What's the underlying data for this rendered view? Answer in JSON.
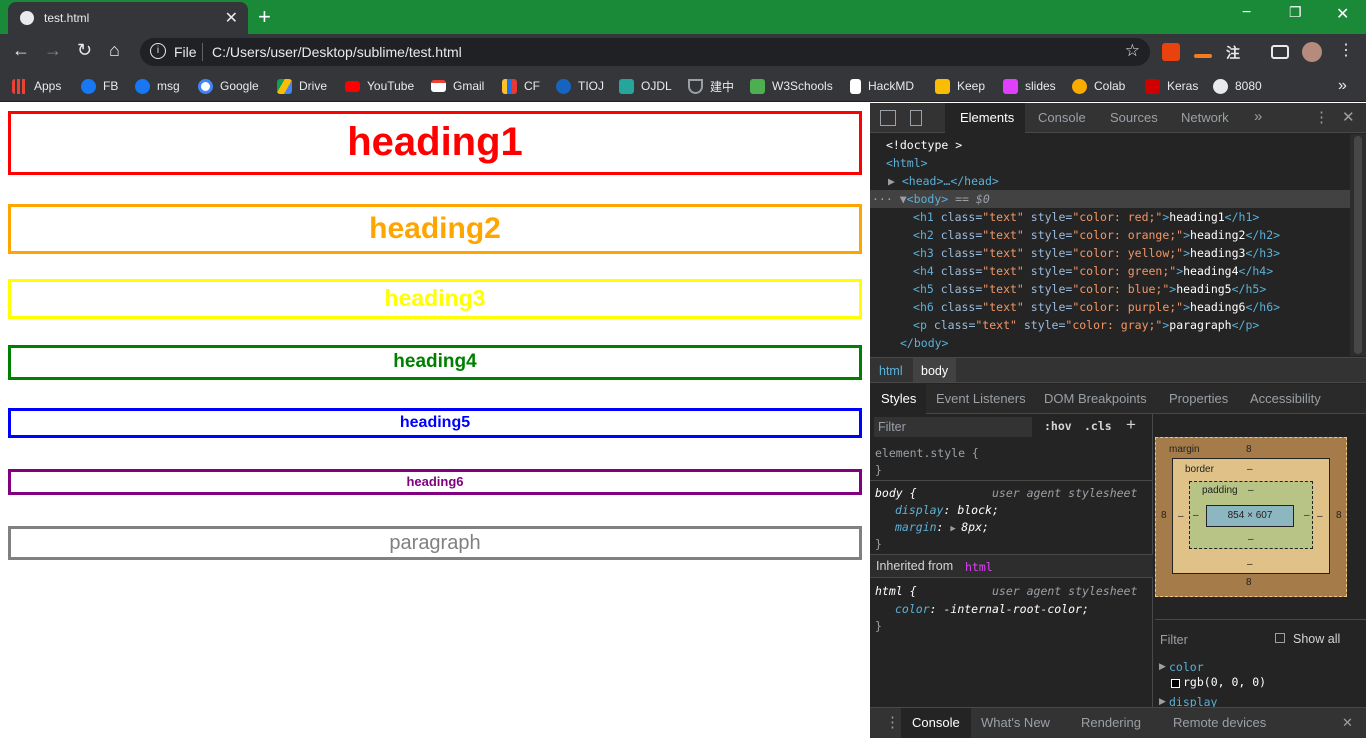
{
  "browser": {
    "tab_title": "test.html",
    "tab_close": "✕",
    "new_tab": "+",
    "window_controls": {
      "minimize": "−",
      "restore": "❐",
      "close": "✕"
    },
    "nav": {
      "back": "←",
      "forward": "→",
      "reload": "↻",
      "home": "⌂"
    },
    "omnibox": {
      "info": "i",
      "scheme": "File",
      "url": "C:/Users/user/Desktop/sublime/test.html",
      "star": "☆"
    },
    "bookmarks": [
      {
        "label": "Apps",
        "icon": "apps-icon",
        "color": "#ea4335"
      },
      {
        "label": "FB",
        "icon": "facebook-icon",
        "color": "#1877f2"
      },
      {
        "label": "msg",
        "icon": "facebook-icon",
        "color": "#1877f2"
      },
      {
        "label": "Google",
        "icon": "google-icon",
        "color": "#ffffff"
      },
      {
        "label": "Drive",
        "icon": "drive-icon",
        "color": "#fbbc04"
      },
      {
        "label": "YouTube",
        "icon": "youtube-icon",
        "color": "#ff0000"
      },
      {
        "label": "Gmail",
        "icon": "gmail-icon",
        "color": "#ffffff"
      },
      {
        "label": "CF",
        "icon": "codeforces-icon",
        "color": "#1a73e8"
      },
      {
        "label": "TIOJ",
        "icon": "tioj-icon",
        "color": "#ffffff"
      },
      {
        "label": "OJDL",
        "icon": "ojdl-icon",
        "color": "#ffffff"
      },
      {
        "label": "建中",
        "icon": "school-icon",
        "color": "#9aa0a6"
      },
      {
        "label": "W3Schools",
        "icon": "w3schools-icon",
        "color": "#4caf50"
      },
      {
        "label": "HackMD",
        "icon": "document-icon",
        "color": "#ffffff"
      },
      {
        "label": "Keep",
        "icon": "keep-icon",
        "color": "#fbbc04"
      },
      {
        "label": "slides",
        "icon": "slides-icon",
        "color": "#e040fb"
      },
      {
        "label": "Colab",
        "icon": "colab-icon",
        "color": "#f9ab00"
      },
      {
        "label": "Keras",
        "icon": "keras-icon",
        "color": "#d00000"
      },
      {
        "label": "8080",
        "icon": "globe-icon",
        "color": "#ffffff"
      }
    ],
    "bookmarks_more": "»"
  },
  "page": {
    "headings": [
      {
        "text": "heading1",
        "color": "red"
      },
      {
        "text": "heading2",
        "color": "orange"
      },
      {
        "text": "heading3",
        "color": "yellow"
      },
      {
        "text": "heading4",
        "color": "green"
      },
      {
        "text": "heading5",
        "color": "blue"
      },
      {
        "text": "heading6",
        "color": "purple"
      },
      {
        "text": "paragraph",
        "color": "gray"
      }
    ]
  },
  "devtools": {
    "tabs": [
      "Elements",
      "Console",
      "Sources",
      "Network"
    ],
    "more_tabs": "»",
    "dom": {
      "doctype": "<!doctype >",
      "html_open": "<html>",
      "head": "<head>…</head>",
      "body_open": "<body>",
      "body_eq": "== $0",
      "body_close": "</body>",
      "lines": [
        {
          "tag": "h1",
          "attr": "class",
          "cls": "\"text\"",
          "style": "\"color: red;\"",
          "text": "heading1"
        },
        {
          "tag": "h2",
          "attr": "class",
          "cls": "\"text\"",
          "style": "\"color: orange;\"",
          "text": "heading2"
        },
        {
          "tag": "h3",
          "attr": "class",
          "cls": "\"text\"",
          "style": "\"color: yellow;\"",
          "text": "heading3"
        },
        {
          "tag": "h4",
          "attr": "class",
          "cls": "\"text\"",
          "style": "\"color: green;\"",
          "text": "heading4"
        },
        {
          "tag": "h5",
          "attr": "class",
          "cls": "\"text\"",
          "style": "\"color: blue;\"",
          "text": "heading5"
        },
        {
          "tag": "h6",
          "attr": "class",
          "cls": "\"text\"",
          "style": "\"color: purple;\"",
          "text": "heading6"
        },
        {
          "tag": "p",
          "attr": "class",
          "cls": "\"text\"",
          "style": "\"color: gray;\"",
          "text": "paragraph"
        }
      ]
    },
    "breadcrumbs": [
      "html",
      "body"
    ],
    "sub_tabs": [
      "Styles",
      "Event Listeners",
      "DOM Breakpoints",
      "Properties",
      "Accessibility"
    ],
    "styles": {
      "filter_placeholder": "Filter",
      "hov": ":hov",
      "cls": ".cls",
      "plus": "+",
      "element_style": "element.style {",
      "close_brace": "}",
      "body_rule": "body {",
      "ua_label": "user agent stylesheet",
      "display_prop": "display",
      "display_val": "block;",
      "margin_prop": "margin",
      "margin_val": "8px;",
      "inherited_label": "Inherited from",
      "inherited_tag": "html",
      "html_rule": "html {",
      "color_prop": "color",
      "color_val": "-internal-root-color;"
    },
    "box_model": {
      "margin_label": "margin",
      "border_label": "border",
      "padding_label": "padding",
      "margin_top": "8",
      "margin_bottom": "8",
      "margin_left": "8",
      "margin_right": "8",
      "dash": "–",
      "content": "854 × 607"
    },
    "computed": {
      "filter_placeholder": "Filter",
      "show_all": "Show all",
      "color_name": "color",
      "color_value": "rgb(0, 0, 0)",
      "display_name": "display"
    },
    "drawer_tabs": [
      "Console",
      "What's New",
      "Rendering",
      "Remote devices"
    ]
  }
}
